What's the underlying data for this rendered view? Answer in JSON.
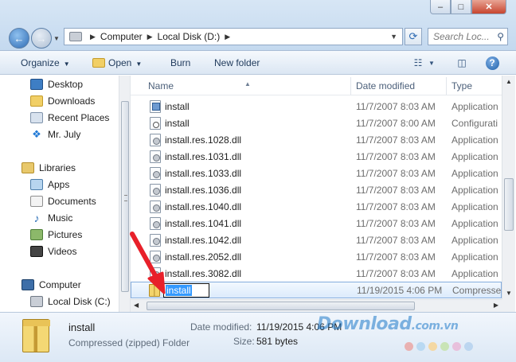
{
  "address": {
    "segments": [
      "Computer",
      "Local Disk (D:)"
    ]
  },
  "search": {
    "placeholder": "Search Loc..."
  },
  "window_controls": {
    "minimize": "‒",
    "maximize": "□",
    "close": "✕"
  },
  "toolbar": {
    "organize": "Organize",
    "open": "Open",
    "burn": "Burn",
    "new_folder": "New folder"
  },
  "nav": {
    "favorites": [
      "Desktop",
      "Downloads",
      "Recent Places",
      "Mr. July"
    ],
    "libraries_label": "Libraries",
    "libraries": [
      "Apps",
      "Documents",
      "Music",
      "Pictures",
      "Videos"
    ],
    "computer_label": "Computer",
    "drives": [
      "Local Disk (C:)"
    ]
  },
  "columns": {
    "name": "Name",
    "date": "Date modified",
    "type": "Type"
  },
  "files": [
    {
      "name": "install",
      "date": "11/7/2007 8:03 AM",
      "type": "Application",
      "icon": "exe-icon"
    },
    {
      "name": "install",
      "date": "11/7/2007 8:00 AM",
      "type": "Configurati",
      "icon": "config-icon"
    },
    {
      "name": "install.res.1028.dll",
      "date": "11/7/2007 8:03 AM",
      "type": "Application",
      "icon": "dll-icon"
    },
    {
      "name": "install.res.1031.dll",
      "date": "11/7/2007 8:03 AM",
      "type": "Application",
      "icon": "dll-icon"
    },
    {
      "name": "install.res.1033.dll",
      "date": "11/7/2007 8:03 AM",
      "type": "Application",
      "icon": "dll-icon"
    },
    {
      "name": "install.res.1036.dll",
      "date": "11/7/2007 8:03 AM",
      "type": "Application",
      "icon": "dll-icon"
    },
    {
      "name": "install.res.1040.dll",
      "date": "11/7/2007 8:03 AM",
      "type": "Application",
      "icon": "dll-icon"
    },
    {
      "name": "install.res.1041.dll",
      "date": "11/7/2007 8:03 AM",
      "type": "Application",
      "icon": "dll-icon"
    },
    {
      "name": "install.res.1042.dll",
      "date": "11/7/2007 8:03 AM",
      "type": "Application",
      "icon": "dll-icon"
    },
    {
      "name": "install.res.2052.dll",
      "date": "11/7/2007 8:03 AM",
      "type": "Application",
      "icon": "dll-icon"
    },
    {
      "name": "install.res.3082.dll",
      "date": "11/7/2007 8:03 AM",
      "type": "Application",
      "icon": "dll-icon"
    }
  ],
  "selected_file": {
    "rename_value": "install",
    "date": "11/19/2015 4:06 PM",
    "type": "Compresse",
    "icon": "zip-folder-icon"
  },
  "details": {
    "name": "install",
    "type": "Compressed (zipped) Folder",
    "date_label": "Date modified:",
    "date_value": "11/19/2015 4:06 PM",
    "size_label": "Size:",
    "size_value": "581 bytes"
  },
  "watermark": {
    "text": "Download",
    "suffix": ".com.vn"
  },
  "colors": {
    "annotation_arrow": "#e8202a",
    "selection_highlight": "#3399ff",
    "watermark_dots": [
      "#e9b1b1",
      "#b9d9f2",
      "#f4d8a3",
      "#c9e4b6",
      "#e8c0dc",
      "#bcd6f0"
    ]
  }
}
